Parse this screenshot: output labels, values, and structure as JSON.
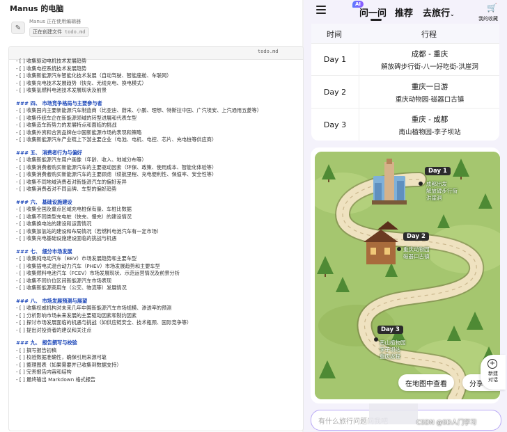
{
  "left_panel": {
    "title": "Manus 的电脑",
    "status": "Manus 正在使用编辑器",
    "action": "正在创建文件",
    "action_file": "todo.md",
    "editor_filename": "todo.md",
    "lines": [
      {
        "type": "t",
        "text": "- [ ] 收集驱动电机技术发展趋势"
      },
      {
        "type": "t",
        "text": "- [ ] 收集电控系统技术发展趋势"
      },
      {
        "type": "t",
        "text": "- [ ] 收集新能源汽车智能化技术发展（自动驾驶、智能座舱、车联网）"
      },
      {
        "type": "t",
        "text": "- [ ] 收集充电技术发展趋势（快充、无线充电、换电模式）"
      },
      {
        "type": "t",
        "text": "- [ ] 收集氢燃料电池技术发展现状及前景"
      },
      {
        "type": "blank",
        "text": ""
      },
      {
        "type": "h",
        "text": "### 四、 市场竞争格局与主要参与者"
      },
      {
        "type": "t",
        "text": "- [ ] 收集国内主要新能源汽车制造商（比亚迪、蔚来、小鹏、理想、特斯拉中国、广汽埃安、上汽通用五菱等）"
      },
      {
        "type": "t",
        "text": "- [ ] 收集传统车企在新能源领域的转型进展和代表车型"
      },
      {
        "type": "t",
        "text": "- [ ] 收集造车新势力的发展特点和面临的挑战"
      },
      {
        "type": "t",
        "text": "- [ ] 收集外资和合资品牌在中国新能源市场的表现和策略"
      },
      {
        "type": "t",
        "text": "- [ ] 收集新能源汽车产业链上下游主要企业（电池、电机、电控、芯片、充电桩等供应商）"
      },
      {
        "type": "blank",
        "text": ""
      },
      {
        "type": "h",
        "text": "### 五、 消费者行为与偏好"
      },
      {
        "type": "t",
        "text": "- [ ] 收集新能源汽车用户画像（年龄、收入、地域分布等）"
      },
      {
        "type": "t",
        "text": "- [ ] 收集消费者购买新能源汽车的主要驱动因素（环保、政策、使用成本、智能化体验等）"
      },
      {
        "type": "t",
        "text": "- [ ] 收集消费者购买新能源汽车的主要顾虑（续航里程、充电便利性、保值率、安全性等）"
      },
      {
        "type": "t",
        "text": "- [ ] 收集不同地域消费者对新能源汽车的偏好差异"
      },
      {
        "type": "t",
        "text": "- [ ] 收集消费者对不同品牌、车型的偏好趋势"
      },
      {
        "type": "blank",
        "text": ""
      },
      {
        "type": "h",
        "text": "### 六、 基础设施建设"
      },
      {
        "type": "t",
        "text": "- [ ] 收集全国及重点区域充电桩保有量、车桩比数据"
      },
      {
        "type": "t",
        "text": "- [ ] 收集不同类型充电桩（快充、慢充）的建设情况"
      },
      {
        "type": "t",
        "text": "- [ ] 收集换电站的建设和运营情况"
      },
      {
        "type": "t",
        "text": "- [ ] 收集加氢站的建设和布局情况（若燃料电池汽车有一定市场）"
      },
      {
        "type": "t",
        "text": "- [ ] 收集充电基础设施建设面临的挑战与机遇"
      },
      {
        "type": "blank",
        "text": ""
      },
      {
        "type": "h",
        "text": "### 七、 细分市场发展"
      },
      {
        "type": "t",
        "text": "- [ ] 收集纯电动汽车（BEV）市场发展趋势和主要车型"
      },
      {
        "type": "t",
        "text": "- [ ] 收集插电式混合动力汽车（PHEV）市场发展趋势和主要车型"
      },
      {
        "type": "t",
        "text": "- [ ] 收集燃料电池汽车（FCEV）市场发展现状、示范运营情况及前景分析"
      },
      {
        "type": "t",
        "text": "- [ ] 收集不同价位区间新能源汽车市场表现"
      },
      {
        "type": "t",
        "text": "- [ ] 收集新能源商用车（公交、物流等）发展情况"
      },
      {
        "type": "blank",
        "text": ""
      },
      {
        "type": "h",
        "text": "### 八、 市场发展预测与展望"
      },
      {
        "type": "t",
        "text": "- [ ] 收集权威机构对未来几年中国新能源汽车市场规模、渗透率的预测"
      },
      {
        "type": "t",
        "text": "- [ ] 分析影响市场未来发展的主要驱动因素和制约因素"
      },
      {
        "type": "t",
        "text": "- [ ] 探讨市场发展面临的机遇与挑战（如供应链安全、技术瓶颈、国际竞争等）"
      },
      {
        "type": "t",
        "text": "- [ ] 提出对投资者的建议和关注点"
      },
      {
        "type": "blank",
        "text": ""
      },
      {
        "type": "h",
        "text": "### 九、 报告撰写与校验"
      },
      {
        "type": "t",
        "text": "- [ ] 撰写报告初稿"
      },
      {
        "type": "t",
        "text": "- [ ] 校验数据准确性，确保引用来源可靠"
      },
      {
        "type": "t",
        "text": "- [ ] 整理图表（如果需要并已收集到数据支持）"
      },
      {
        "type": "t",
        "text": "- [ ] 完善报告内容和结构"
      },
      {
        "type": "t",
        "text": "- [ ] 最终输出 Markdown 格式报告"
      }
    ]
  },
  "right_panel": {
    "nav": {
      "ai_badge": "AI",
      "tabs": [
        "问一问",
        "推荐",
        "去旅行"
      ],
      "cart_label": "我的收藏"
    },
    "schedule": {
      "headers": [
        "时间",
        "行程"
      ],
      "rows": [
        {
          "day": "Day 1",
          "route": "成都 - 重庆",
          "detail": "解放碑步行街-八一好吃街-洪崖洞"
        },
        {
          "day": "Day 2",
          "route": "重庆一日游",
          "detail": "重庆动物园-磁器口古镇"
        },
        {
          "day": "Day 3",
          "route": "重庆 - 成都",
          "detail": "南山植物园-李子坝站"
        }
      ]
    },
    "map": {
      "day1_label": "Day 1",
      "day1_pois": [
        "成都出发",
        "解放碑步行街",
        "洪崖洞"
      ],
      "day2_label": "Day 2",
      "day2_pois": [
        "重庆动物园",
        "磁器口古镇"
      ],
      "day3_label": "Day 3",
      "day3_pois": [
        "南山植物园",
        "李子坝站",
        "重庆返程"
      ],
      "view_button": "在地图中查看",
      "share_button": "分享"
    },
    "new_chat": {
      "label_1": "新建",
      "label_2": "对话"
    },
    "chat_placeholder": "有什么旅行问题问我吧",
    "watermark": "CSDN @SD人门学习"
  }
}
